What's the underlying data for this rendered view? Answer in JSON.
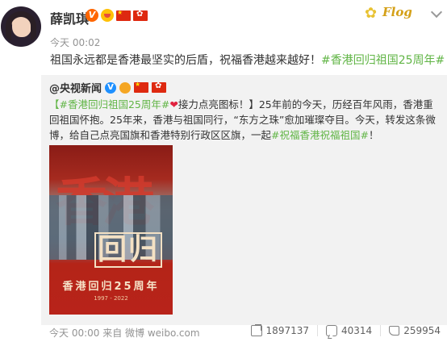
{
  "author": {
    "name": "薛凯琪",
    "timestamp": "今天 00:02",
    "deco_text": "Flog"
  },
  "post": {
    "text_plain": "祖国永远都是香港最坚实的后盾，祝福香港越来越好！",
    "hashtag": "#香港回归祖国25周年#"
  },
  "repost": {
    "author": "@央视新闻",
    "hashtag1": "【#香港回归祖国25周年#",
    "heart": "❤",
    "text1": "接力点亮图标！】25年前的今天，历经百年风雨，香港重回祖国怀抱。25年来，香港与祖国同行，“东方之珠”愈加璀璨夺目。今天，转发这条微博，给自己点亮国旗和香港特别行政区区旗，一起",
    "hashtag2": "#祝福香港祝福祖国#",
    "text2": "！",
    "poster": {
      "big_text": "香港",
      "huigui": "回归",
      "caption": "香港回归25周年",
      "years": "1997 - 2022"
    },
    "footer": "今天 00:00 来自 微博 weibo.com",
    "stats": {
      "shares": "1897137",
      "comments": "40314",
      "likes": "259954"
    }
  }
}
